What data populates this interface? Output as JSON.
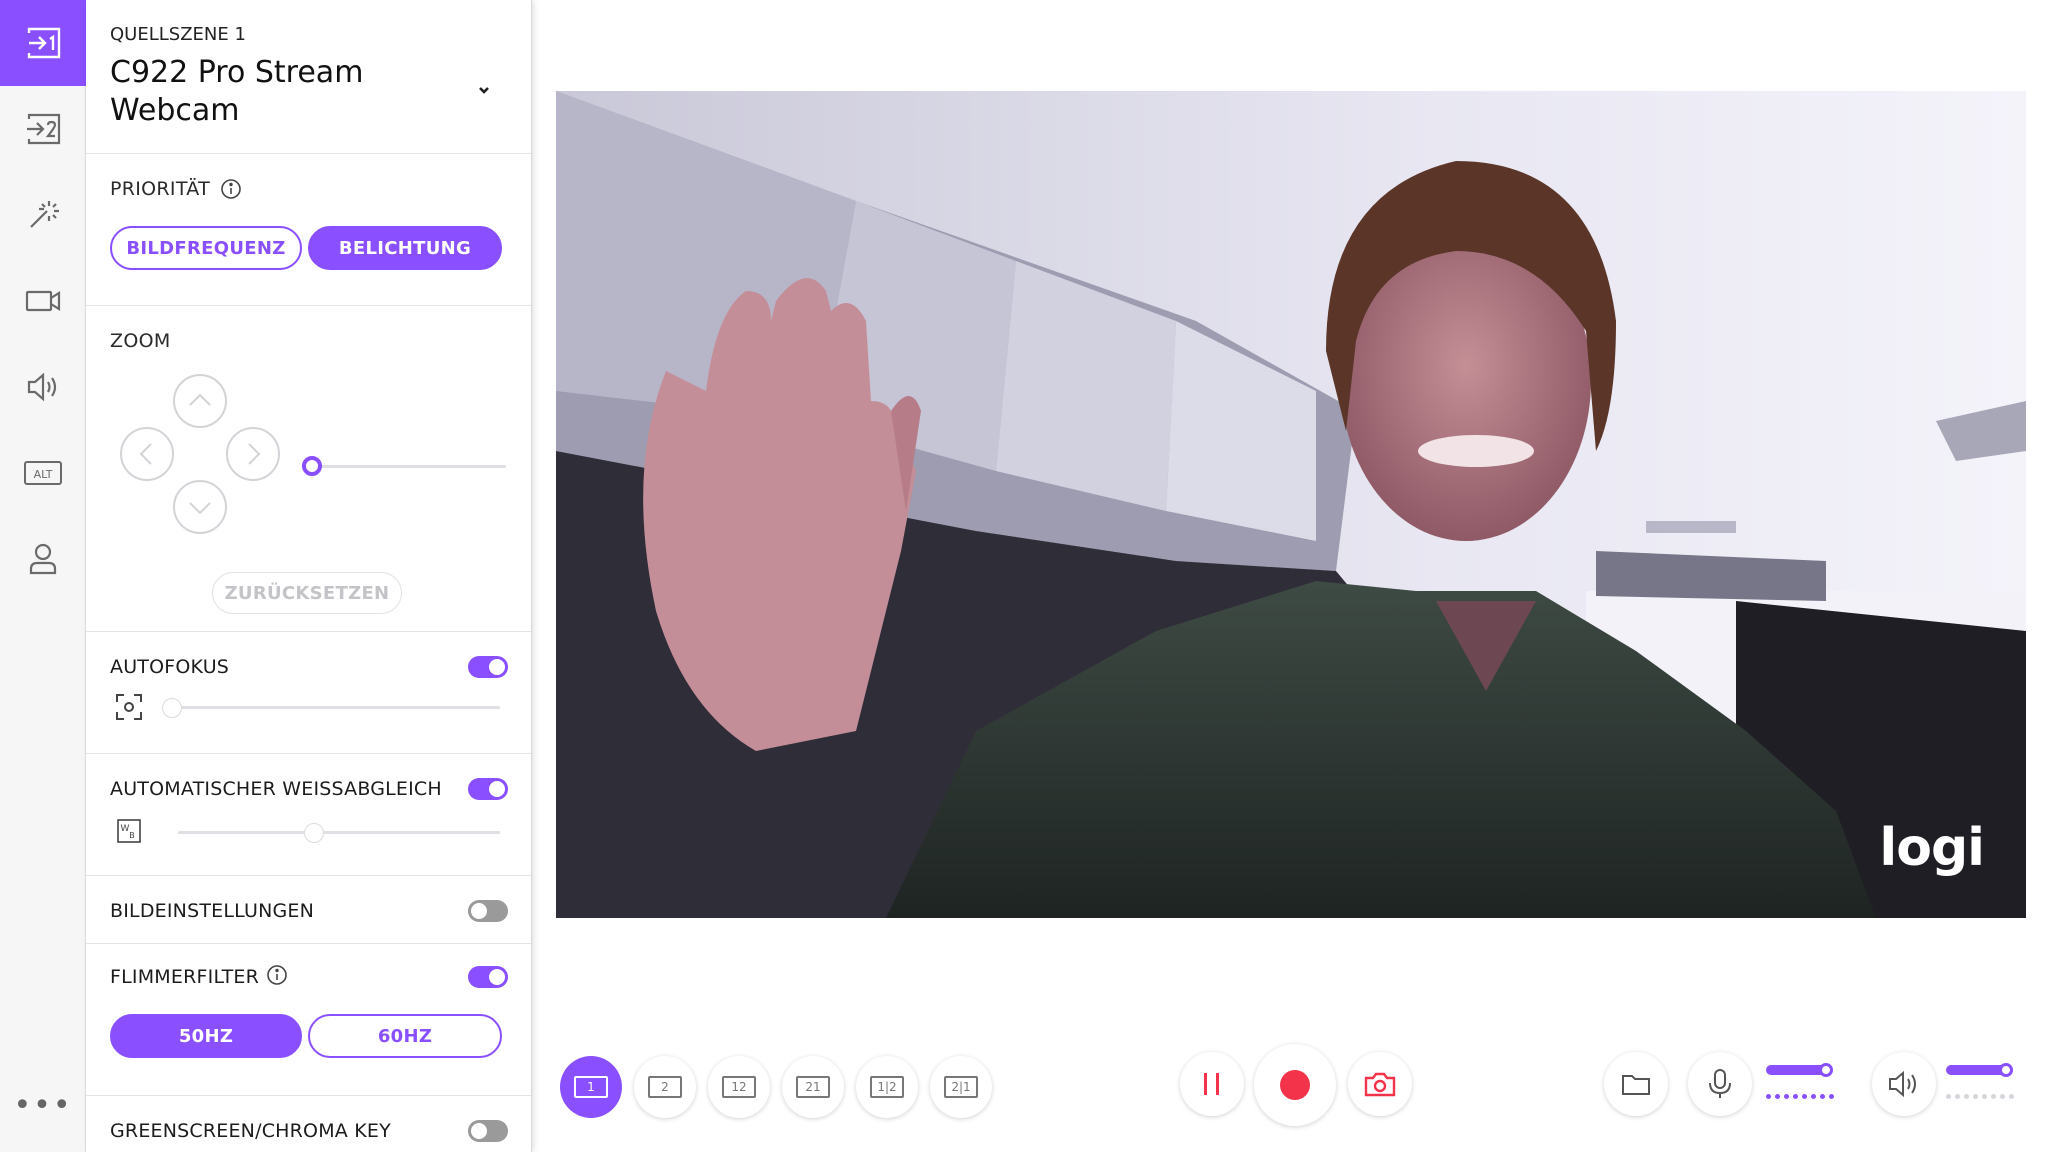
{
  "source": {
    "label": "QUELLSZENE 1",
    "name": "C922 Pro Stream Webcam"
  },
  "priority": {
    "label": "PRIORITÄT",
    "options": [
      "BILDFREQUENZ",
      "BELICHTUNG"
    ],
    "selected": "BELICHTUNG"
  },
  "zoom": {
    "label": "ZOOM",
    "value": 0,
    "reset_label": "ZURÜCKSETZEN"
  },
  "autofocus": {
    "label": "AUTOFOKUS",
    "enabled": true,
    "value": 0
  },
  "white_balance": {
    "label": "AUTOMATISCHER WEISSABGLEICH",
    "enabled": true,
    "value": 0.43
  },
  "image_settings": {
    "label": "BILDEINSTELLUNGEN",
    "enabled": false
  },
  "flicker": {
    "label": "FLIMMERFILTER",
    "enabled": true,
    "options": [
      "50HZ",
      "60HZ"
    ],
    "selected": "50HZ"
  },
  "greenscreen": {
    "label": "GREENSCREEN/CHROMA KEY",
    "enabled": false
  },
  "rail": {
    "items": [
      "source-1-icon",
      "source-2-icon",
      "effects-wand-icon",
      "camera-icon",
      "speaker-icon",
      "alt-icon",
      "profile-icon"
    ],
    "active": "source-1-icon",
    "more_label": "•••"
  },
  "preview": {
    "logo_text": "logi"
  },
  "bottom_bar": {
    "layouts": [
      "1",
      "2",
      "12",
      "21",
      "1|2",
      "2|1"
    ],
    "active_layout": "1",
    "mic_level": 0.95,
    "speaker_level": 0.95
  },
  "colors": {
    "accent": "#8a4fff",
    "record": "#f2334a",
    "toggle_off": "#9a9a9a"
  }
}
